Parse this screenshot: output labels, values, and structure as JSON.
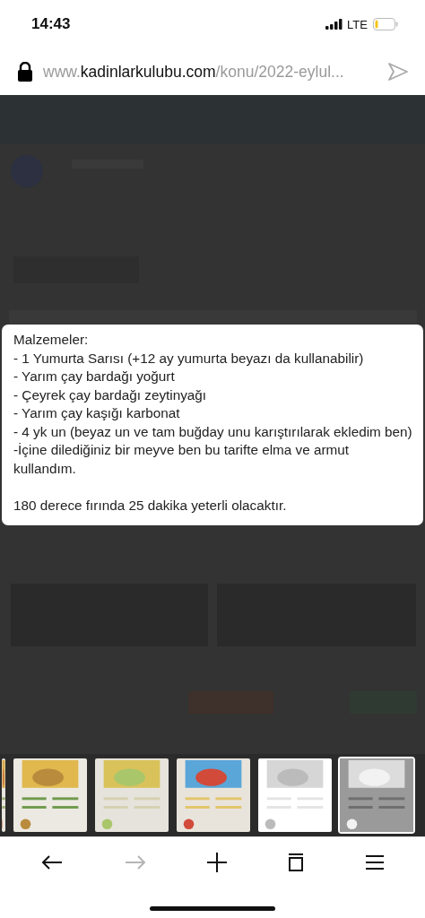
{
  "status_bar": {
    "time": "14:43",
    "network": "LTE"
  },
  "address_bar": {
    "url_prefix": "www.",
    "domain": "kadinlarkulubu.com",
    "path": "/konu/2022-eylul..."
  },
  "post_card": {
    "paragraphs": [
      [
        "Malzemeler:",
        "- 1 Yumurta Sarısı (+12 ay yumurta beyazı da kullanabilir)",
        "- Yarım çay bardağı yoğurt",
        "- Çeyrek çay bardağı zeytinyağı",
        "- Yarım çay kaşığı karbonat",
        "- 4 yk un (beyaz un ve tam buğday unu karıştırılarak ekledim ben)",
        "-İçine dilediğiniz bir meyve ben bu tarifte elma ve armut kullandım."
      ],
      [
        "180 derece fırında 25 dakika yeterli olacaktır."
      ]
    ]
  },
  "thumbnails": [
    {
      "kind": "picture",
      "selected": false
    },
    {
      "kind": "picture",
      "selected": false
    },
    {
      "kind": "picture",
      "selected": false
    },
    {
      "kind": "picture",
      "selected": false
    },
    {
      "kind": "picture",
      "selected": false
    },
    {
      "kind": "picture",
      "selected": true
    }
  ],
  "toolbar": [
    {
      "kind": "back",
      "disabled": false
    },
    {
      "kind": "forward",
      "disabled": true
    },
    {
      "kind": "new",
      "disabled": false
    },
    {
      "kind": "tabs",
      "disabled": false
    },
    {
      "kind": "menu",
      "disabled": false
    }
  ]
}
